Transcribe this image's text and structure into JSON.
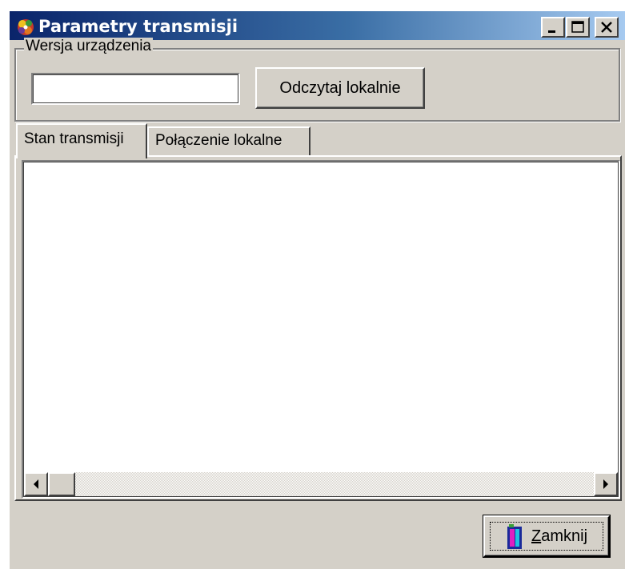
{
  "window": {
    "title": "Parametry transmisji",
    "minimize_icon": "minimize-icon",
    "maximize_icon": "maximize-icon",
    "close_icon": "close-icon"
  },
  "device_version": {
    "group_label": "Wersja urządzenia",
    "value": "",
    "read_button_label": "Odczytaj lokalnie"
  },
  "tabs": [
    {
      "label": "Stan transmisji",
      "active": true
    },
    {
      "label": "Połączenie lokalne",
      "active": false
    }
  ],
  "status_list": {
    "items": []
  },
  "footer": {
    "close_button_label_underlined": "Z",
    "close_button_label_rest": "amknij",
    "close_button_icon": "door-exit-icon"
  },
  "colors": {
    "titlebar_start": "#0a246a",
    "titlebar_end": "#a6caf0",
    "face": "#d4d0c8"
  }
}
